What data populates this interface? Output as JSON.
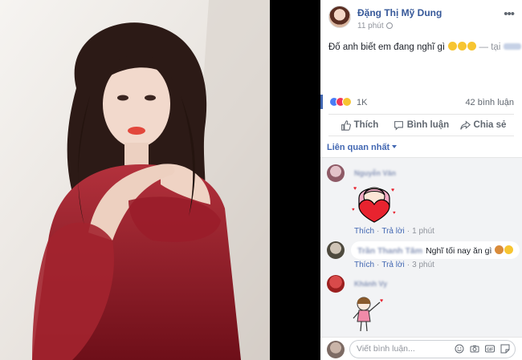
{
  "post": {
    "author": "Đặng Thị Mỹ Dung",
    "time": "11 phút",
    "text": "Đố anh biết em đang nghĩ gì",
    "location_prefix": "— tại"
  },
  "stats": {
    "reaction_count": "1K",
    "comment_count": "42 bình luận"
  },
  "actions": {
    "like": "Thích",
    "comment": "Bình luận",
    "share": "Chia sẻ"
  },
  "sort_label": "Liên quan nhất",
  "comments": [
    {
      "kind": "sticker",
      "sticker": "girl-holding-heart",
      "like": "Thích",
      "reply": "Trả lời",
      "time": "1 phút"
    },
    {
      "kind": "text",
      "text": "Nghĩ tối nay ăn gì",
      "like": "Thích",
      "reply": "Trả lời",
      "time": "3 phút"
    },
    {
      "kind": "sticker",
      "sticker": "girl-waving"
    }
  ],
  "composer": {
    "placeholder": "Viết bình luận..."
  },
  "colors": {
    "link_blue": "#4267b2",
    "name_blue": "#365899",
    "muted": "#90949c",
    "dress_red": "#8d1521"
  }
}
